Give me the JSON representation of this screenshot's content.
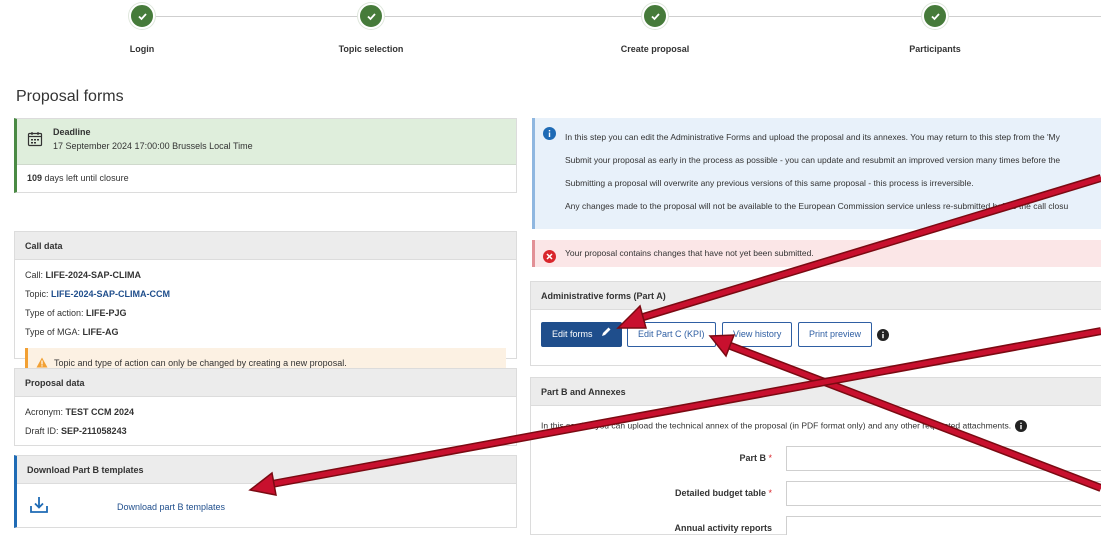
{
  "steps": [
    {
      "label": "Login"
    },
    {
      "label": "Topic selection"
    },
    {
      "label": "Create proposal"
    },
    {
      "label": "Participants"
    }
  ],
  "page_title": "Proposal forms",
  "deadline": {
    "title": "Deadline",
    "date": "17 September 2024 17:00:00 Brussels Local Time",
    "days_left": "109",
    "days_left_text": " days left until closure"
  },
  "call_data": {
    "heading": "Call data",
    "call_label": "Call: ",
    "call_value": "LIFE-2024-SAP-CLIMA",
    "topic_label": "Topic: ",
    "topic_value": "LIFE-2024-SAP-CLIMA-CCM",
    "action_label": "Type of action: ",
    "action_value": "LIFE-PJG",
    "mga_label": "Type of MGA: ",
    "mga_value": "LIFE-AG",
    "warning": "Topic and type of action can only be changed by creating a new proposal."
  },
  "proposal_data": {
    "heading": "Proposal data",
    "acronym_label": "Acronym: ",
    "acronym_value": "TEST CCM 2024",
    "draft_label": "Draft ID: ",
    "draft_value": "SEP-211058243"
  },
  "download": {
    "heading": "Download Part B templates",
    "link": "Download part B templates"
  },
  "info_lines": [
    "In this step you can edit the Administrative Forms and upload the proposal and its annexes. You may return to this step from the 'My",
    "Submit your proposal as early in the process as possible - you can update and resubmit an improved version many times before the",
    "Submitting a proposal will overwrite any previous versions of this same proposal - this process is irreversible.",
    "Any changes made to the proposal will not be available to the European Commission service unless re-submitted before the call closu"
  ],
  "error_text": "Your proposal contains changes that have not yet been submitted.",
  "admin_forms": {
    "heading": "Administrative forms (Part A)",
    "edit_forms": "Edit forms",
    "edit_part_c": "Edit Part C (KPI)",
    "view_history": "View history",
    "print_preview": "Print preview"
  },
  "part_b": {
    "heading": "Part B and Annexes",
    "text": "In this section you can upload the technical annex of the proposal (in PDF format only) and any other requested attachments.",
    "fields": [
      {
        "label": "Part B",
        "required": "*"
      },
      {
        "label": "Detailed budget table",
        "required": "*"
      },
      {
        "label": "Annual activity reports",
        "required": ""
      }
    ]
  },
  "colors": {
    "step_green": "#467b3a",
    "primary_blue": "#1f4e8c",
    "arrow_red": "#c8102e",
    "deadline_bg": "#dfeedc",
    "info_bg": "#e8f1fa",
    "error_bg": "#fbe6e7",
    "warn_bg": "#fcf1e3"
  }
}
